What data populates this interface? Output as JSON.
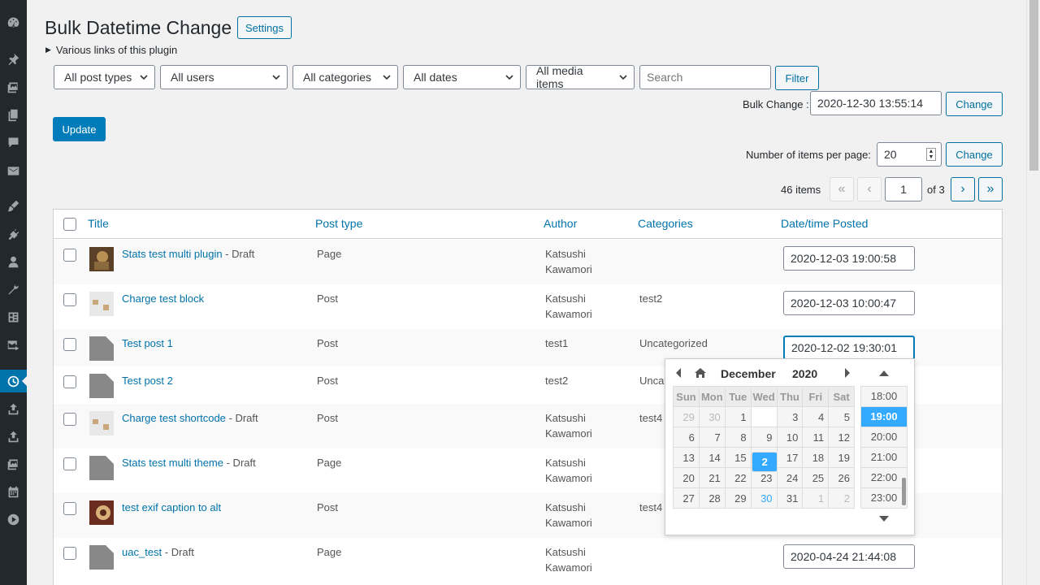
{
  "page": {
    "title": "Bulk Datetime Change",
    "settings_button": "Settings",
    "links_summary": "Various links of this plugin"
  },
  "filters": {
    "post_types": "All post types",
    "users": "All users",
    "categories": "All categories",
    "dates": "All dates",
    "media": "All media items",
    "search_placeholder": "Search",
    "filter_button": "Filter"
  },
  "bulk": {
    "label": "Bulk Change :",
    "value": "2020-12-30 13:55:14",
    "change_button": "Change"
  },
  "update_button": "Update",
  "per_page": {
    "label": "Number of items per page:",
    "value": "20",
    "change_button": "Change"
  },
  "pagination": {
    "items_text": "46 items",
    "first": "«",
    "prev": "‹",
    "current_page": "1",
    "of_text": "of 3",
    "next": "›",
    "last": "»"
  },
  "table": {
    "headers": [
      "Title",
      "Post type",
      "Author",
      "Categories",
      "Date/time Posted"
    ],
    "rows": [
      {
        "title": "Stats test multi plugin",
        "status": " - Draft",
        "type": "Page",
        "author1": "Katsushi",
        "author2": "Kawamori",
        "category": "",
        "date": "2020-12-03 19:00:58",
        "thumb": "photo-dark"
      },
      {
        "title": "Charge test block",
        "status": "",
        "type": "Post",
        "author1": "Katsushi",
        "author2": "Kawamori",
        "category": "test2",
        "date": "2020-12-03 10:00:47",
        "thumb": "photo-light"
      },
      {
        "title": "Test post 1",
        "status": "",
        "type": "Post",
        "author1": "test1",
        "author2": "",
        "category": "Uncategorized",
        "date": "2020-12-02 19:30:01",
        "thumb": "document-icon"
      },
      {
        "title": "Test post 2",
        "status": "",
        "type": "Post",
        "author1": "test2",
        "author2": "",
        "category": "Uncat",
        "date": "",
        "thumb": "document-icon"
      },
      {
        "title": "Charge test shortcode",
        "status": " - Draft",
        "type": "Post",
        "author1": "Katsushi",
        "author2": "Kawamori",
        "category": "test4",
        "date": "",
        "thumb": "photo-light"
      },
      {
        "title": "Stats test multi theme",
        "status": " - Draft",
        "type": "Page",
        "author1": "Katsushi",
        "author2": "Kawamori",
        "category": "",
        "date": "",
        "thumb": "document-icon"
      },
      {
        "title": "test exif caption to alt",
        "status": "",
        "type": "Post",
        "author1": "Katsushi",
        "author2": "Kawamori",
        "category": "test4",
        "date": "",
        "thumb": "photo-ring"
      },
      {
        "title": "uac_test",
        "status": " - Draft",
        "type": "Page",
        "author1": "Katsushi",
        "author2": "Kawamori",
        "category": "",
        "date": "2020-04-24 21:44:08",
        "thumb": "document-icon"
      }
    ]
  },
  "datepicker": {
    "month": "December",
    "year": "2020",
    "weekdays": [
      "Sun",
      "Mon",
      "Tue",
      "Wed",
      "Thu",
      "Fri",
      "Sat"
    ],
    "weeks": [
      [
        "29",
        "30",
        "1",
        "2",
        "3",
        "4",
        "5"
      ],
      [
        "6",
        "7",
        "8",
        "9",
        "10",
        "11",
        "12"
      ],
      [
        "13",
        "14",
        "15",
        "16",
        "17",
        "18",
        "19"
      ],
      [
        "20",
        "21",
        "22",
        "23",
        "24",
        "25",
        "26"
      ],
      [
        "27",
        "28",
        "29",
        "30",
        "31",
        "1",
        "2"
      ]
    ],
    "selected_day": "2",
    "today_day": "30",
    "times": [
      "18:00",
      "19:00",
      "20:00",
      "21:00",
      "22:00",
      "23:00"
    ],
    "selected_time": "19:00"
  },
  "colors": {
    "accent": "#0073aa",
    "primary_button": "#007cba",
    "picker_highlight": "#33aaff",
    "sidebar": "#23282d"
  },
  "sidebar_icons": [
    "dashboard-icon",
    "posts-pin-icon",
    "media-icon",
    "pages-icon",
    "comments-icon",
    "mail-icon",
    "appearance-brush-icon",
    "plugins-icon",
    "users-icon",
    "tools-wrench-icon",
    "settings-icon",
    "mail-forward-icon",
    "clock-icon",
    "upload-icon",
    "upload-icon",
    "media-icon",
    "calendar-icon",
    "play-icon"
  ]
}
